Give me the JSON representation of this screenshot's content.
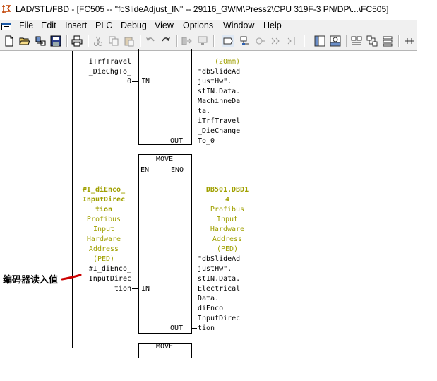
{
  "window": {
    "title": "LAD/STL/FBD  - [FC505 -- \"fcSlideAdjust_IN\" -- 29116_GWM\\Press2\\CPU 319F-3 PN/DP\\...\\FC505]"
  },
  "menubar": {
    "items": [
      "File",
      "Edit",
      "Insert",
      "PLC",
      "Debug",
      "View",
      "Options",
      "Window",
      "Help"
    ]
  },
  "toolbar": {
    "icons": [
      "new-icon",
      "open-icon",
      "accessible-nodes-icon",
      "save-icon",
      "print-icon",
      "cut-icon",
      "copy-icon",
      "paste-icon",
      "undo-icon",
      "redo-icon",
      "load-icon",
      "monitor-icon",
      "toggle-breakpoint-icon",
      "network-icon",
      "online-icon",
      "glasses-icon",
      "step-icon",
      "overview-icon",
      "details-icon",
      "symbol-icon",
      "address-icon",
      "more-icon"
    ]
  },
  "network1": {
    "in_label_1": "iTrfTravel",
    "in_label_2": "_DieChgTo_",
    "in_value": "0",
    "in_pin": "IN",
    "out_pin": "OUT",
    "out_comment": "(20mm)",
    "out_lines": [
      "\"dbSlideAd",
      "justHw\".",
      "stIN.Data.",
      "MachinneDa",
      "ta.",
      "iTrfTravel",
      "_DieChange",
      "To_0"
    ]
  },
  "network2": {
    "block_name": "MOVE",
    "en_pin": "EN",
    "eno_pin": "ENO",
    "in_pin": "IN",
    "out_pin": "OUT",
    "in_symbol": [
      "#I_diEnco_",
      "InputDirec",
      "tion"
    ],
    "in_comment": [
      "Profibus",
      "Input",
      "Hardware",
      "Address",
      "(PED)"
    ],
    "in_operand": [
      "#I_diEnco_",
      "InputDirec",
      "tion"
    ],
    "out_address": [
      "DB501.DBD1",
      "4"
    ],
    "out_comment": [
      "Profibus",
      "Input",
      "Hardware",
      "Address",
      "(PED)"
    ],
    "out_operand": [
      "\"dbSlideAd",
      "justHw\".",
      "stIN.Data.",
      "Electrical",
      "Data.",
      "diEnco_",
      "InputDirec",
      "tion"
    ]
  },
  "network3": {
    "block_name": "MOVE"
  },
  "annotation": {
    "text": "编码器读入值",
    "color": "#cc0000"
  }
}
